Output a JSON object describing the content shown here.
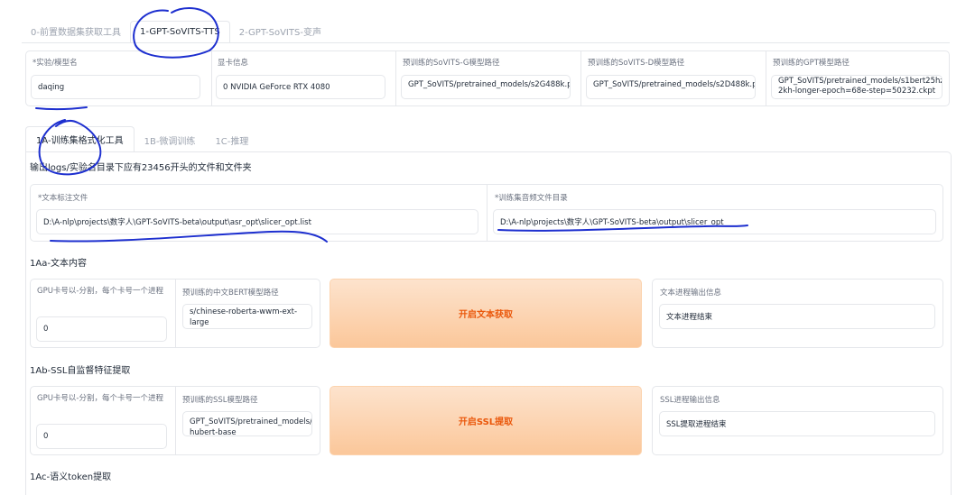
{
  "top_tabs": [
    {
      "label": "0-前置数据集获取工具"
    },
    {
      "label": "1-GPT-SoVITS-TTS"
    },
    {
      "label": "2-GPT-SoVITS-变声"
    }
  ],
  "config": {
    "exp_name": {
      "label": "*实验/模型名",
      "value": "daqing"
    },
    "gpu_info": {
      "label": "显卡信息",
      "value": "0 NVIDIA GeForce RTX 4080"
    },
    "sovits_g": {
      "label": "预训练的SoVITS-G模型路径",
      "value": "GPT_SoVITS/pretrained_models/s2G488k.pth"
    },
    "sovits_d": {
      "label": "预训练的SoVITS-D模型路径",
      "value": "GPT_SoVITS/pretrained_models/s2D488k.pth"
    },
    "gpt": {
      "label": "预训练的GPT模型路径",
      "value": "GPT_SoVITS/pretrained_models/s1bert25hz-2kh-longer-epoch=68e-step=50232.ckpt"
    }
  },
  "sub_tabs": [
    {
      "label": "1A-训练集格式化工具"
    },
    {
      "label": "1B-微调训练"
    },
    {
      "label": "1C-推理"
    }
  ],
  "hint": "输出logs/实验名目录下应有23456开头的文件和文件夹",
  "paths": {
    "list_file": {
      "label": "*文本标注文件",
      "value": "D:\\A-nlp\\projects\\数字人\\GPT-SoVITS-beta\\output\\asr_opt\\slicer_opt.list"
    },
    "wav_dir": {
      "label": "*训练集音频文件目录",
      "value": "D:\\A-nlp\\projects\\数字人\\GPT-SoVITS-beta\\output\\slicer_opt"
    }
  },
  "section_1aa": {
    "title": "1Aa-文本内容",
    "gpu_label": "GPU卡号以-分割，每个卡号一个进程",
    "gpu_value": "0",
    "bert_label": "预训练的中文BERT模型路径",
    "bert_value": "s/chinese-roberta-wwm-ext-large",
    "button": "开启文本获取",
    "output_label": "文本进程输出信息",
    "output_value": "文本进程结束"
  },
  "section_1ab": {
    "title": "1Ab-SSL自监督特征提取",
    "gpu_label": "GPU卡号以-分割，每个卡号一个进程",
    "gpu_value": "0",
    "ssl_label": "预训练的SSL模型路径",
    "ssl_value": "GPT_SoVITS/pretrained_models/chinese-hubert-base",
    "button": "开启SSL提取",
    "output_label": "SSL进程输出信息",
    "output_value": "SSL提取进程结束"
  },
  "section_1ac": {
    "title": "1Ac-语义token提取"
  },
  "colors": {
    "accent": "#ea580c",
    "button_bg": "#fbc79a",
    "annotation": "#1d2fcf"
  }
}
